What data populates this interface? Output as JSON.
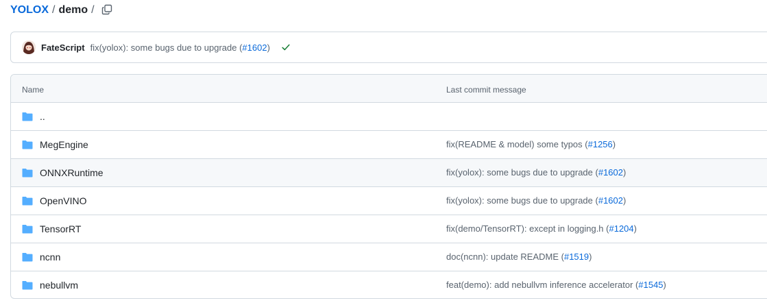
{
  "breadcrumb": {
    "repo": "YOLOX",
    "sep1": "/",
    "dir": "demo",
    "sep2": "/"
  },
  "commit": {
    "author": "FateScript",
    "message_prefix": "fix(yolox): some bugs due to upgrade (",
    "pr": "#1602",
    "message_suffix": ")",
    "status": "success"
  },
  "table": {
    "headers": {
      "name": "Name",
      "message": "Last commit message"
    },
    "rows": [
      {
        "name": "..",
        "msg_prefix": "",
        "pr": "",
        "msg_suffix": ""
      },
      {
        "name": "MegEngine",
        "msg_prefix": "fix(README & model) some typos (",
        "pr": "#1256",
        "msg_suffix": ")"
      },
      {
        "name": "ONNXRuntime",
        "msg_prefix": "fix(yolox): some bugs due to upgrade (",
        "pr": "#1602",
        "msg_suffix": ")"
      },
      {
        "name": "OpenVINO",
        "msg_prefix": "fix(yolox): some bugs due to upgrade (",
        "pr": "#1602",
        "msg_suffix": ")"
      },
      {
        "name": "TensorRT",
        "msg_prefix": "fix(demo/TensorRT): except in logging.h (",
        "pr": "#1204",
        "msg_suffix": ")"
      },
      {
        "name": "ncnn",
        "msg_prefix": "doc(ncnn): update README (",
        "pr": "#1519",
        "msg_suffix": ")"
      },
      {
        "name": "nebullvm",
        "msg_prefix": "feat(demo): add nebullvm inference accelerator (",
        "pr": "#1545",
        "msg_suffix": ")"
      }
    ]
  },
  "colors": {
    "link": "#0969da",
    "folder": "#54aeff",
    "success": "#1a7f37",
    "border": "#d1d9e0"
  },
  "icons": {
    "copy": "copy-icon",
    "folder": "folder-icon",
    "check": "check-icon"
  }
}
